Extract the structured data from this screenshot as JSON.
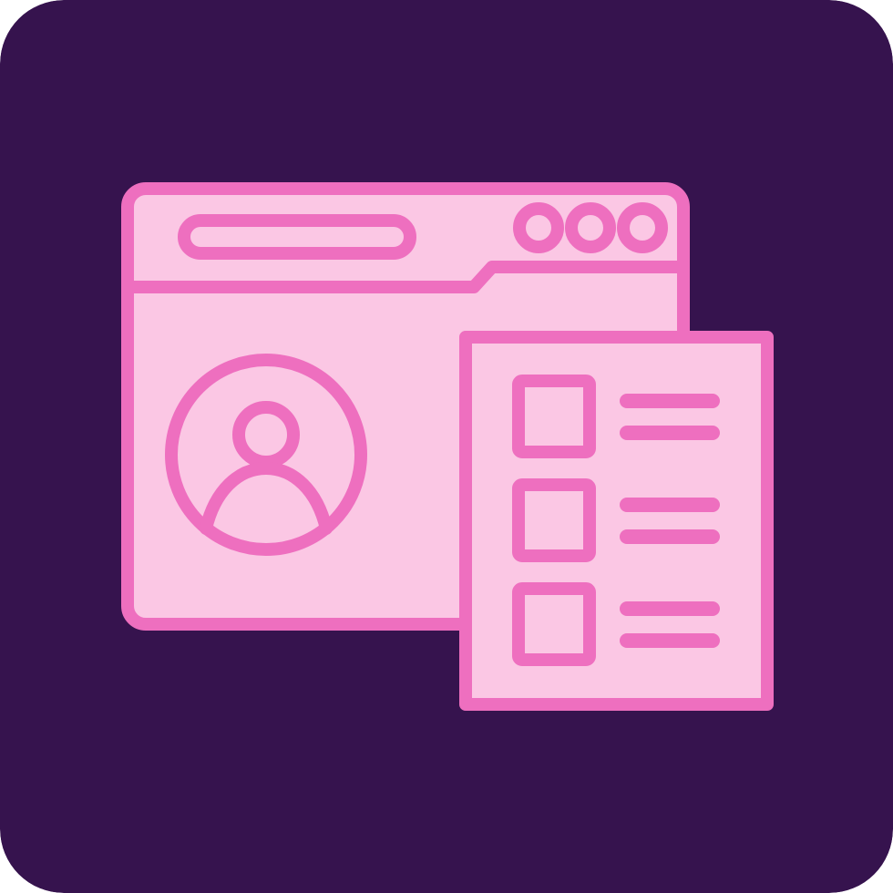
{
  "icon": {
    "name": "user-profile-checklist-icon",
    "colors": {
      "background": "#36134E",
      "stroke": "#EE6FBF",
      "fill": "#FBC7E4"
    },
    "checklist": {
      "items": [
        {
          "name": "checklist-item-1"
        },
        {
          "name": "checklist-item-2"
        },
        {
          "name": "checklist-item-3"
        }
      ]
    }
  }
}
